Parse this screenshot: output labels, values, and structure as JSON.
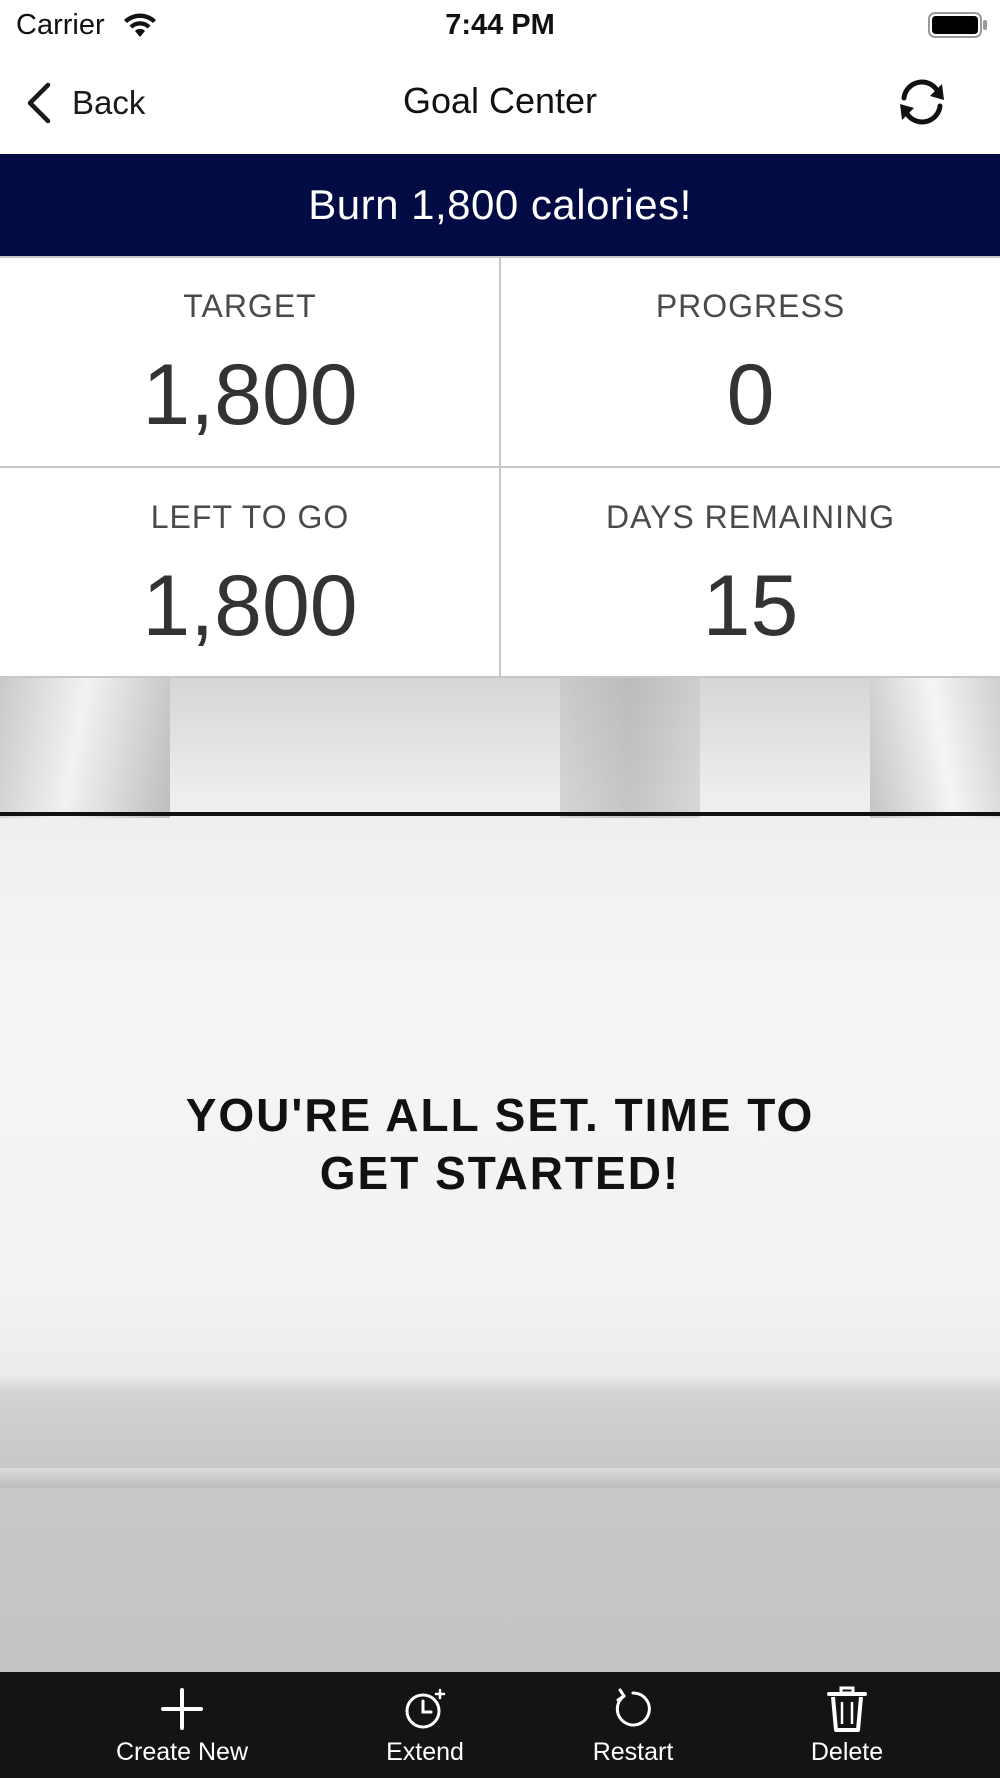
{
  "status_bar": {
    "carrier": "Carrier",
    "time": "7:44 PM"
  },
  "nav": {
    "back_label": "Back",
    "title": "Goal Center",
    "icons": {
      "back": "chevron-left-icon",
      "refresh": "refresh-icon"
    }
  },
  "banner": {
    "text": "Burn 1,800 calories!",
    "color": "#030b45"
  },
  "stats": {
    "target": {
      "label": "TARGET",
      "value": "1,800"
    },
    "progress": {
      "label": "PROGRESS",
      "value": "0"
    },
    "left_to_go": {
      "label": "LEFT TO GO",
      "value": "1,800"
    },
    "days_remaining": {
      "label": "DAYS REMAINING",
      "value": "15"
    }
  },
  "hero": {
    "message": "YOU'RE ALL SET. TIME TO\nGET STARTED!"
  },
  "tab_bar": {
    "items": [
      {
        "label": "Create New",
        "icon": "plus-icon"
      },
      {
        "label": "Extend",
        "icon": "clock-plus-icon"
      },
      {
        "label": "Restart",
        "icon": "restart-icon"
      },
      {
        "label": "Delete",
        "icon": "trash-icon"
      }
    ]
  }
}
